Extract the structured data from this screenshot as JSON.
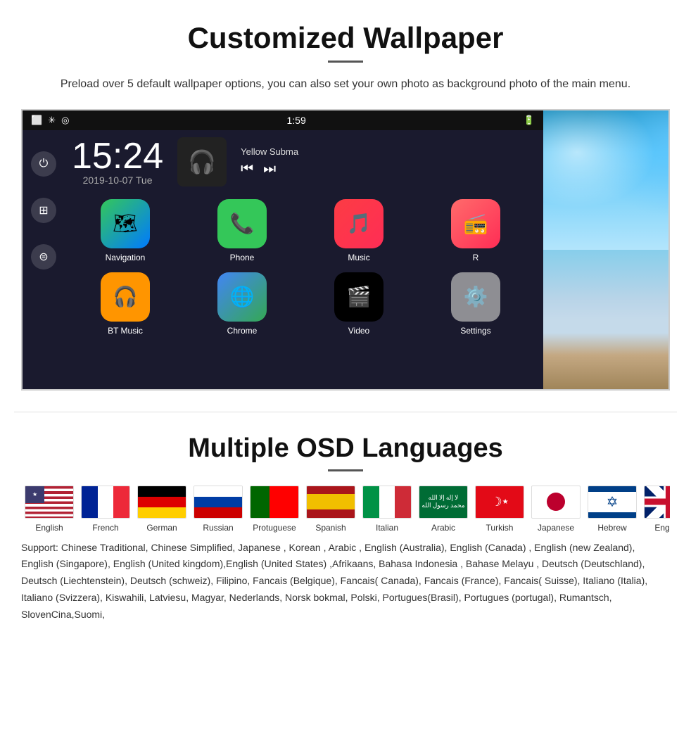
{
  "wallpaper_section": {
    "title": "Customized Wallpaper",
    "description": "Preload over 5 default wallpaper options, you can also set your own photo as background photo of the main menu.",
    "screen": {
      "time": "1:59",
      "clock": "15:24",
      "date": "2019-10-07  Tue",
      "music_title": "Yellow Subma",
      "apps": [
        {
          "label": "Navigation",
          "icon": "🗺"
        },
        {
          "label": "Phone",
          "icon": "📞"
        },
        {
          "label": "Music",
          "icon": "🎵"
        },
        {
          "label": "R",
          "icon": "📻"
        },
        {
          "label": "BT Music",
          "icon": "🎧"
        },
        {
          "label": "Chrome",
          "icon": "🌐"
        },
        {
          "label": "Video",
          "icon": "🎬"
        },
        {
          "label": "Settings",
          "icon": "⚙️"
        }
      ]
    }
  },
  "languages_section": {
    "title": "Multiple OSD Languages",
    "flags": [
      {
        "label": "English",
        "type": "usa"
      },
      {
        "label": "French",
        "type": "france"
      },
      {
        "label": "German",
        "type": "germany"
      },
      {
        "label": "Russian",
        "type": "russia"
      },
      {
        "label": "Protuguese",
        "type": "portugal"
      },
      {
        "label": "Spanish",
        "type": "spain"
      },
      {
        "label": "Italian",
        "type": "italy"
      },
      {
        "label": "Arabic",
        "type": "arabic"
      },
      {
        "label": "Turkish",
        "type": "turkey"
      },
      {
        "label": "Japanese",
        "type": "japan"
      },
      {
        "label": "Hebrew",
        "type": "israel"
      },
      {
        "label": "English",
        "type": "uk"
      }
    ],
    "support_text": "Support: Chinese Traditional, Chinese Simplified, Japanese , Korean , Arabic , English (Australia), English (Canada) , English (new Zealand), English (Singapore), English (United kingdom),English (United States) ,Afrikaans, Bahasa Indonesia , Bahase Melayu , Deutsch (Deutschland), Deutsch (Liechtenstein), Deutsch (schweiz), Filipino, Fancais (Belgique), Fancais( Canada), Fancais (France), Fancais( Suisse), Italiano (Italia), Italiano (Svizzera), Kiswahili, Latviesu, Magyar, Nederlands, Norsk bokmal, Polski, Portugues(Brasil), Portugues (portugal), Rumantsch, SlovenCina,Suomi,"
  }
}
